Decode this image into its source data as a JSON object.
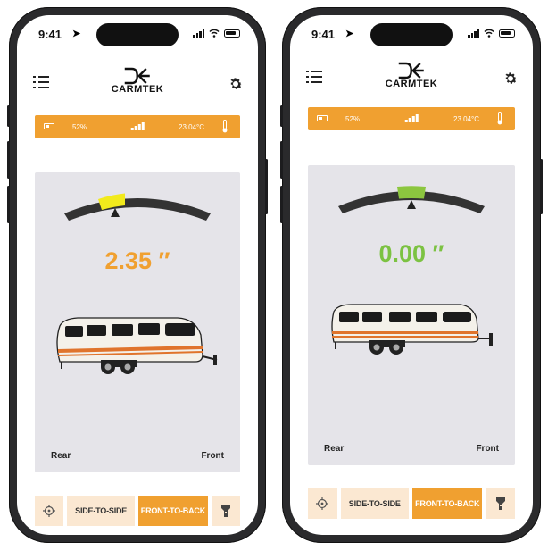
{
  "colors": {
    "accent": "#f0a030",
    "panel_bg": "#e5e4e9",
    "nav_inactive_bg": "#fbe8d2",
    "gauge_track": "#333333",
    "reading_off_level": "#f0a030",
    "reading_level": "#7cc242",
    "gauge_marker_off": "#f2ea1c",
    "gauge_marker_level": "#8cc63f"
  },
  "screens": [
    {
      "status_bar": {
        "time": "9:41"
      },
      "header": {
        "logo_text": "CARMTEK",
        "menu_icon": "hamburger-list-icon",
        "settings_icon": "gear-icon"
      },
      "info_bar": {
        "battery_percent": "52%",
        "temperature": "23.04°C",
        "icons": [
          "battery-icon",
          "signal-icon",
          "thermometer-icon"
        ]
      },
      "level": {
        "reading": "2.35 ″",
        "rear_label": "Rear",
        "front_label": "Front",
        "gauge_state": "off-level"
      },
      "nav": {
        "side_to_side": "SIDE-TO-SIDE",
        "front_to_back": "FRONT-TO-BACK",
        "active": "front_to_back",
        "icons": [
          "target-icon",
          "flashlight-icon"
        ]
      }
    },
    {
      "status_bar": {
        "time": "9:41"
      },
      "header": {
        "logo_text": "CARMTEK",
        "menu_icon": "hamburger-list-icon",
        "settings_icon": "gear-icon"
      },
      "info_bar": {
        "battery_percent": "52%",
        "temperature": "23.04°C",
        "icons": [
          "battery-icon",
          "signal-icon",
          "thermometer-icon"
        ]
      },
      "level": {
        "reading": "0.00 ″",
        "rear_label": "Rear",
        "front_label": "Front",
        "gauge_state": "level"
      },
      "nav": {
        "side_to_side": "SIDE-TO-SIDE",
        "front_to_back": "FRONT-TO-BACK",
        "active": "front_to_back",
        "icons": [
          "target-icon",
          "flashlight-icon"
        ]
      }
    }
  ]
}
